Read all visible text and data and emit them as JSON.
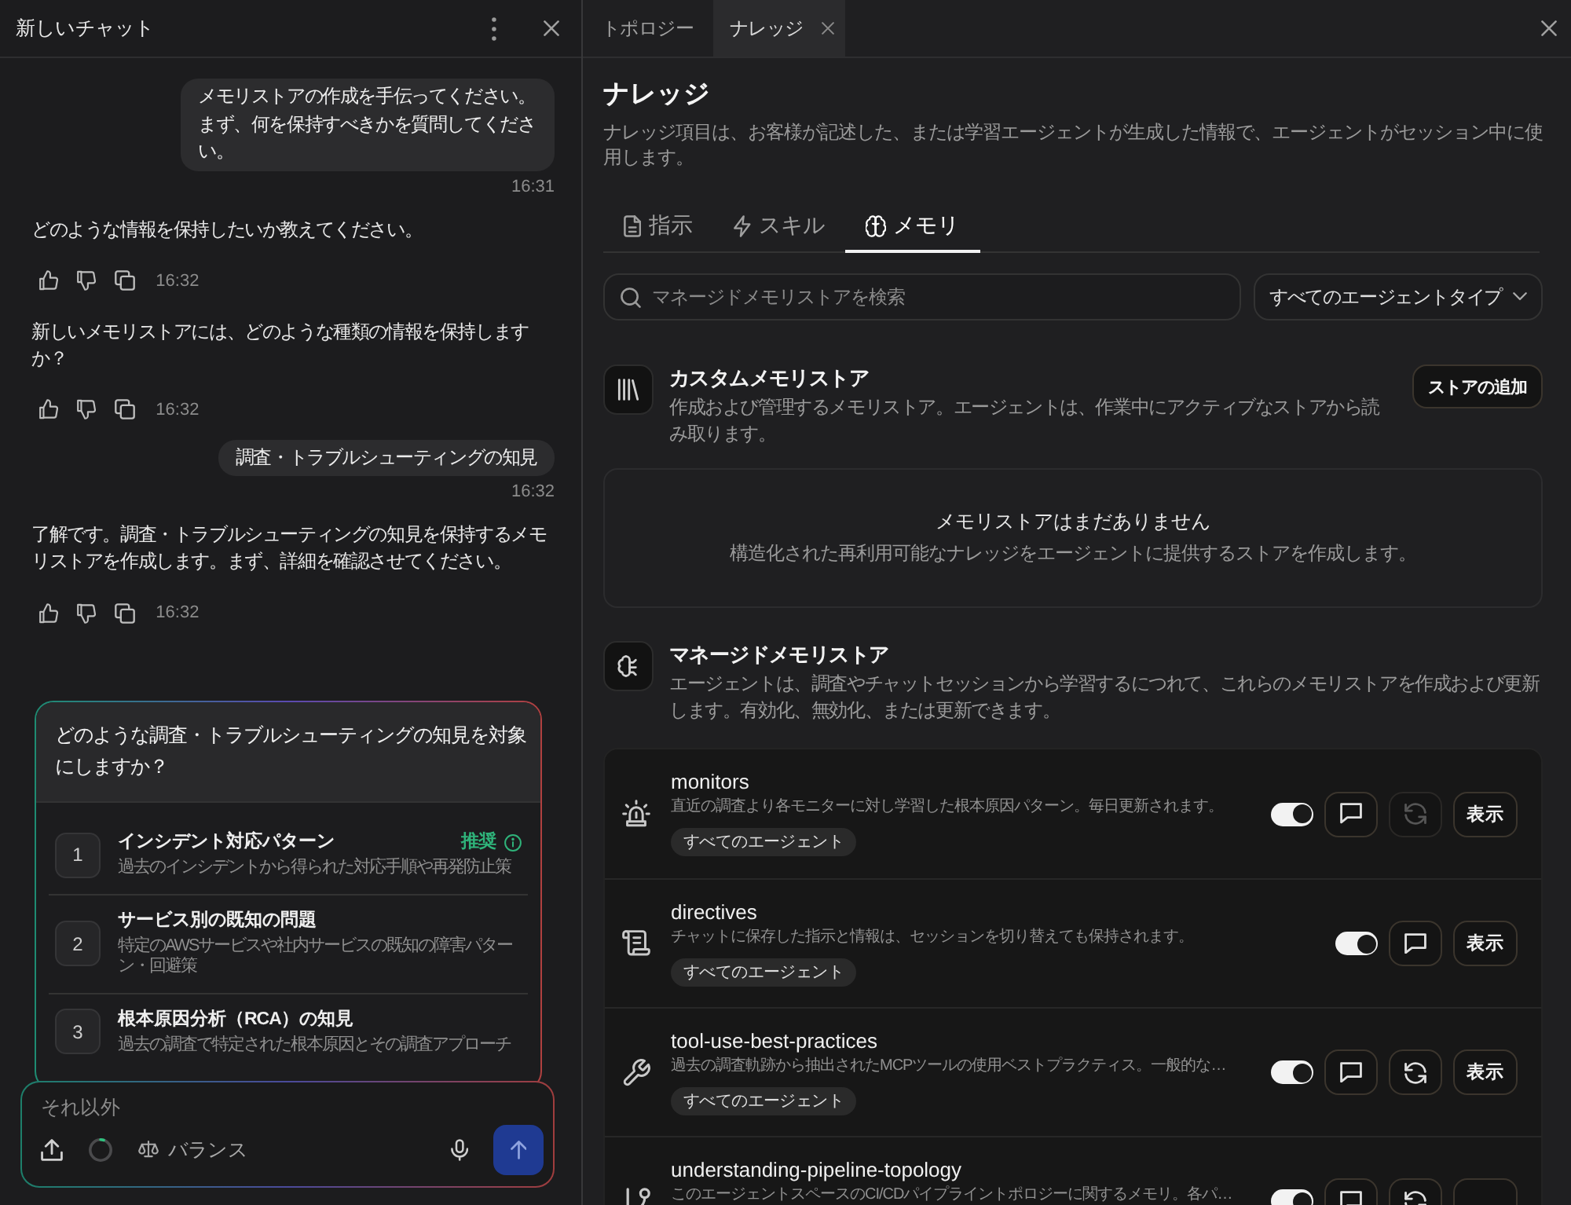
{
  "chat_panel": {
    "title": "新しいチャット",
    "messages": [
      {
        "kind": "user",
        "text": "メモリストアの作成を手伝ってください。まず、何を保持すべきかを質問してください。",
        "time": "16:31"
      },
      {
        "kind": "assistant",
        "text": "どのような情報を保持したいか教えてください。",
        "time": "16:32"
      },
      {
        "kind": "assistant",
        "text": "新しいメモリストアには、どのような種類の情報を保持しますか？",
        "time": "16:32"
      },
      {
        "kind": "user",
        "text": "調査・トラブルシューティングの知見",
        "time": "16:32"
      },
      {
        "kind": "assistant",
        "text": "了解です。調査・トラブルシューティングの知見を保持するメモリストアを作成します。まず、詳細を確認させてください。",
        "time": "16:32"
      }
    ],
    "question_card": {
      "question": "どのような調査・トラブルシューティングの知見を対象にしますか？",
      "options": [
        {
          "number": "1",
          "title": "インシデント対応パターン",
          "description": "過去のインシデントから得られた対応手順や再発防止策",
          "badge": "推奨"
        },
        {
          "number": "2",
          "title": "サービス別の既知の問題",
          "description": "特定のAWSサービスや社内サービスの既知の障害パターン・回避策"
        },
        {
          "number": "3",
          "title": "根本原因分析（RCA）の知見",
          "description": "過去の調査で特定された根本原因とその調査アプローチ"
        }
      ]
    },
    "composer": {
      "placeholder": "それ以外",
      "usage_meter": {
        "level": 0.05
      },
      "mode": "バランス"
    }
  },
  "knowledge_panel": {
    "tabs": [
      {
        "label": "トポロジー",
        "selected": false,
        "closable": false
      },
      {
        "label": "ナレッジ",
        "selected": true,
        "closable": true
      }
    ],
    "title": "ナレッジ",
    "description": "ナレッジ項目は、お客様が記述した、または学習エージェントが生成した情報で、エージェントがセッション中に使用します。",
    "sub_tabs": [
      {
        "label": "指示",
        "selected": false
      },
      {
        "label": "スキル",
        "selected": false
      },
      {
        "label": "メモリ",
        "selected": true
      }
    ],
    "search": {
      "placeholder": "マネージドメモリストアを検索"
    },
    "agent_type_filter": {
      "value": "すべてのエージェントタイプ"
    },
    "custom_stores": {
      "title": "カスタムメモリストア",
      "description": "作成および管理するメモリストア。エージェントは、作業中にアクティブなストアから読み取ります。",
      "add_button": "ストアの追加",
      "empty_state": {
        "title": "メモリストアはまだありません",
        "description": "構造化された再利用可能なナレッジをエージェントに提供するストアを作成します。"
      }
    },
    "managed_stores": {
      "title": "マネージドメモリストア",
      "description": "エージェントは、調査やチャットセッションから学習するにつれて、これらのメモリストアを作成および更新します。有効化、無効化、または更新できます。",
      "stores": [
        {
          "name": "monitors",
          "description": "直近の調査より各モニターに対し学習した根本原因パターン。毎日更新されます。",
          "scope": "すべてのエージェント",
          "enabled": true,
          "refresh": {
            "disabled": true
          },
          "view_button": "表示"
        },
        {
          "name": "directives",
          "description": "チャットに保存した指示と情報は、セッションを切り替えても保持されます。",
          "scope": "すべてのエージェント",
          "enabled": true,
          "view_button": "表示"
        },
        {
          "name": "tool-use-best-practices",
          "description": "過去の調査軌跡から抽出されたMCPツールの使用ベストプラクティス。一般的な…",
          "scope": "すべてのエージェント",
          "enabled": true,
          "refresh": {
            "disabled": false
          },
          "view_button": "表示"
        },
        {
          "name": "understanding-pipeline-topology",
          "description": "このエージェントスペースのCI/CDパイプライントポロジーに関するメモリ。各パ…",
          "enabled": true,
          "refresh": {
            "disabled": false
          }
        }
      ]
    }
  }
}
